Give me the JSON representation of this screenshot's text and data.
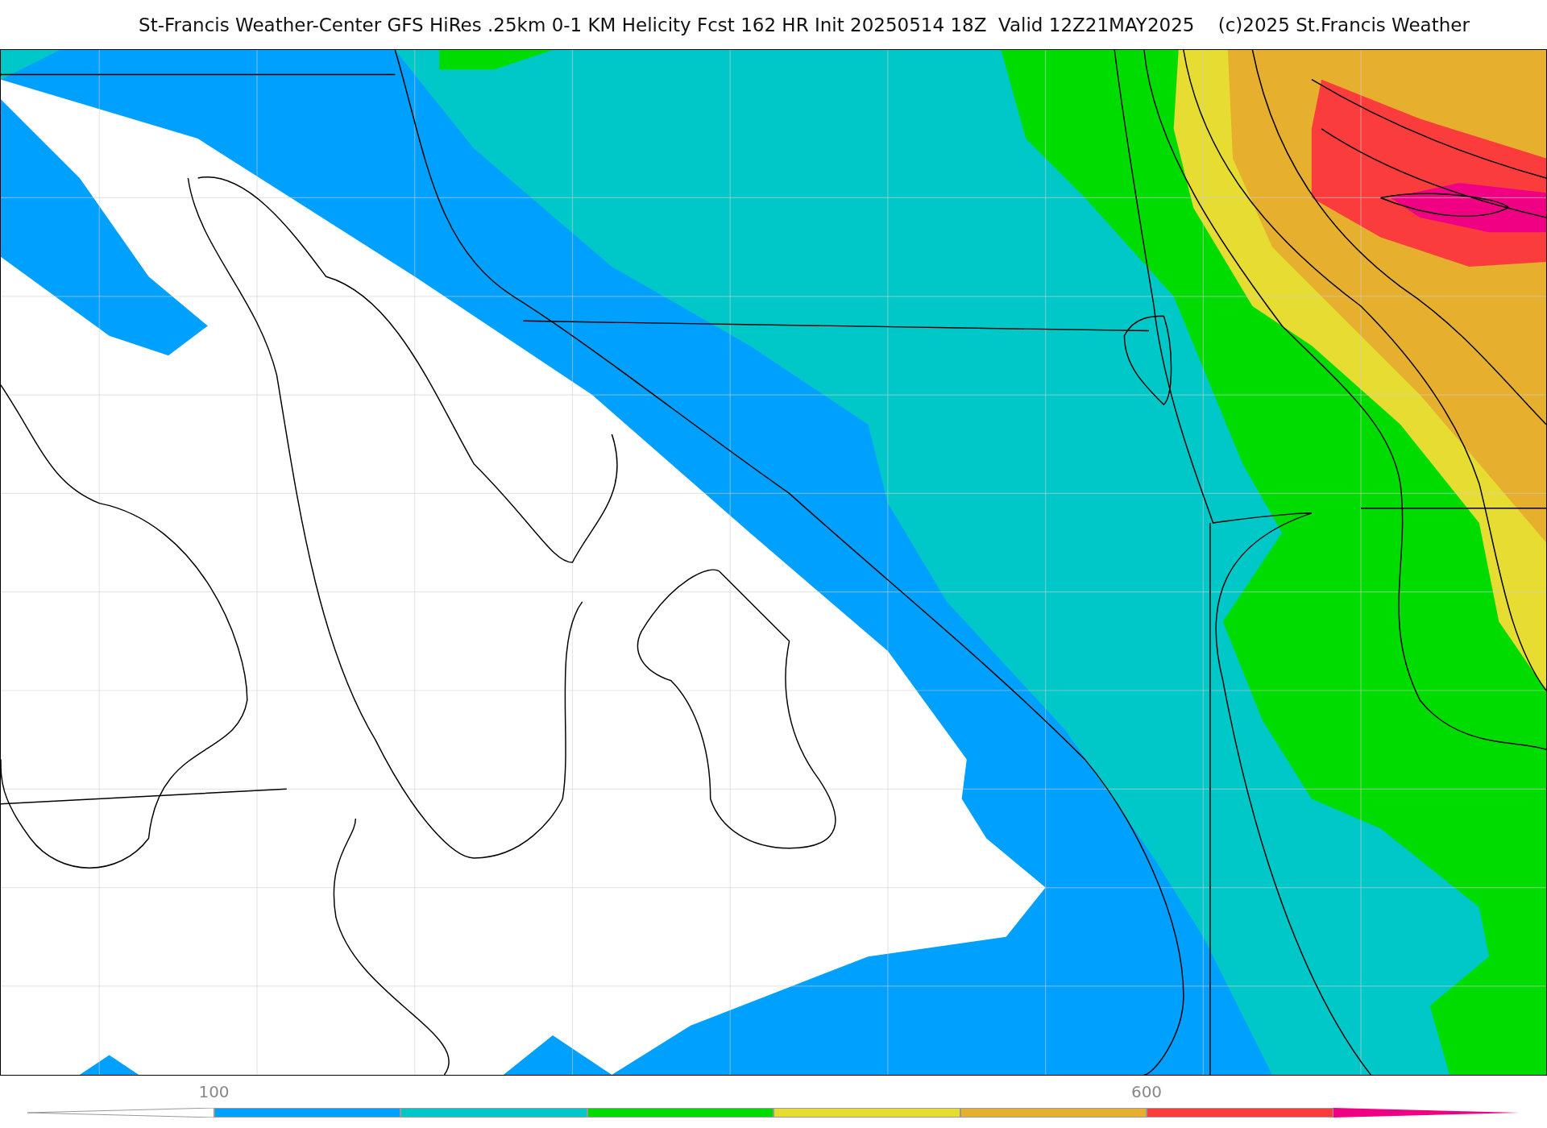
{
  "title": "St-Francis Weather-Center GFS HiRes .25km 0-1 KM Helicity Fcst 162 HR Init 20250514 18Z  Valid 12Z21MAY2025    (c)2025 St.Francis Weather",
  "colorbar": {
    "segments": [
      {
        "kind": "low-triangle"
      },
      {
        "kind": "band",
        "color": "#00a0ff",
        "label": "100"
      },
      {
        "kind": "band",
        "color": "#00c8c8"
      },
      {
        "kind": "band",
        "color": "#00dc00"
      },
      {
        "kind": "band",
        "color": "#e6dc32"
      },
      {
        "kind": "band",
        "color": "#e6af2d"
      },
      {
        "kind": "band",
        "color": "#fa3c3c",
        "label": "600"
      },
      {
        "kind": "high-triangle",
        "color": "#f00082"
      }
    ]
  }
}
